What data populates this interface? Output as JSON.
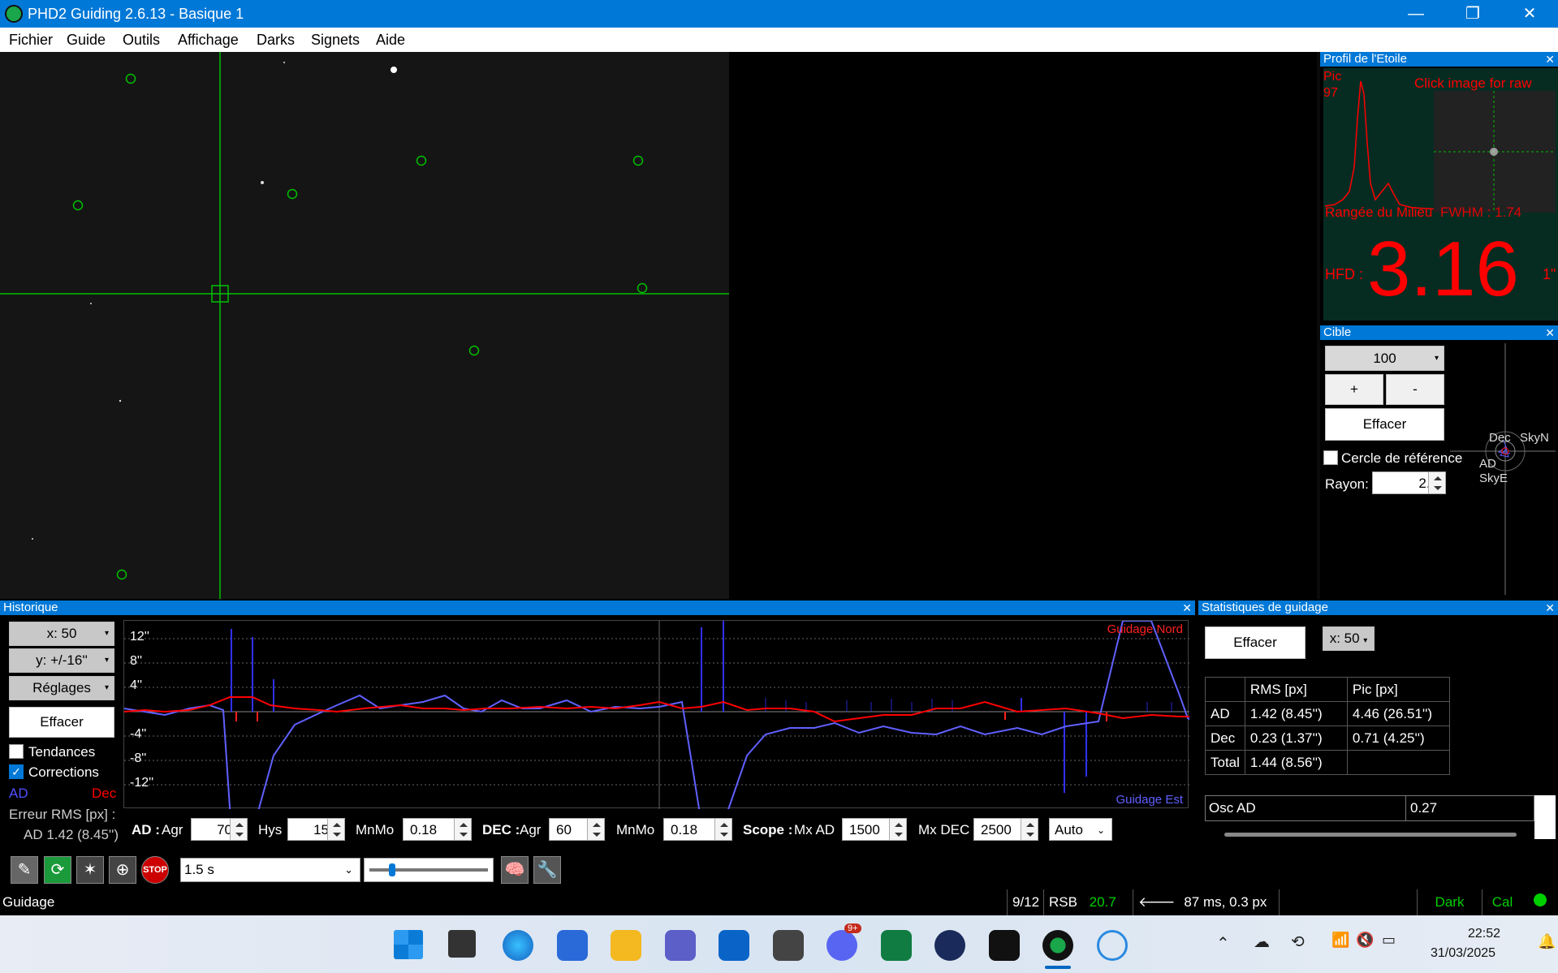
{
  "window": {
    "title": "PHD2 Guiding 2.6.13 - Basique 1",
    "minimize": "—",
    "maximize": "❐",
    "close": "✕"
  },
  "menu": [
    "Fichier",
    "Guide",
    "Outils",
    "Affichage",
    "Darks",
    "Signets",
    "Aide"
  ],
  "profile": {
    "header": "Profil de l'Etoile",
    "pic_label": "Pic",
    "pic_value": "97",
    "click_hint": "Click image for raw",
    "mid_row": "Rangée du Milieu",
    "fwhm": "FWHM : 1.74",
    "hfd_label": "HFD :",
    "hfd_value": "3.16",
    "hfd_suffix": "1\""
  },
  "target": {
    "header": "Cible",
    "scale": "100",
    "plus": "+",
    "minus": "-",
    "clear": "Effacer",
    "ref_circle": "Cercle de référence",
    "radius_label": "Rayon:",
    "radius_value": "2.0",
    "dec_label": "Dec",
    "skyn": "SkyN",
    "ad_label": "AD",
    "skye": "SkyE"
  },
  "history": {
    "header": "Historique",
    "x_scale": "x:  50",
    "y_scale": "y: +/-16''",
    "settings": "Réglages",
    "clear": "Effacer",
    "trends": "Tendances",
    "corrections": "Corrections",
    "ra_label": "AD",
    "dec_label": "Dec",
    "rms_title": "Erreur RMS [px] :",
    "rms_value": "AD 1.42 (8.45'')",
    "guide_north": "Guidage Nord",
    "guide_east": "Guidage Est",
    "y_ticks": [
      "12''",
      "8''",
      "4''",
      "-4''",
      "-8''",
      "-12''"
    ],
    "ra_agr_label": "AD :",
    "agr": "Agr",
    "ra_agr": "70",
    "hys_label": "Hys",
    "hys": "15",
    "mnmo_label": "MnMo",
    "ra_mnmo": "0.18",
    "dec_agr_label": "DEC :",
    "dec_agr": "60",
    "dec_mnmo": "0.18",
    "scope_label": "Scope :",
    "mx_ad_label": "Mx AD",
    "mx_ad": "1500",
    "mx_dec_label": "Mx DEC",
    "mx_dec": "2500",
    "mode": "Auto"
  },
  "stats": {
    "header": "Statistiques de guidage",
    "clear": "Effacer",
    "x_scale": "x: 50",
    "columns": [
      "",
      "RMS [px]",
      "Pic [px]"
    ],
    "rows": [
      [
        "AD",
        "1.42 (8.45'')",
        "4.46 (26.51'')"
      ],
      [
        "Dec",
        "0.23 (1.37'')",
        "0.71 (4.25'')"
      ],
      [
        "Total",
        "1.44 (8.56'')",
        ""
      ]
    ],
    "osc_label": "Osc AD",
    "osc_value": "0.27"
  },
  "toolbar": {
    "exposure": "1.5 s"
  },
  "status": {
    "state": "Guidage",
    "frames": "9/12",
    "snr_label": "RSB",
    "snr_value": "20.7",
    "pulse": "87 ms, 0.3 px",
    "dark": "Dark",
    "cal": "Cal"
  },
  "taskbar": {
    "time": "22:52",
    "date": "31/03/2025",
    "badge": "9+"
  },
  "colors": {
    "accent": "#0078d7",
    "ra": "#5050ff",
    "dec": "#ff0000",
    "star_circle": "#00c000",
    "snr": "#00d000"
  }
}
